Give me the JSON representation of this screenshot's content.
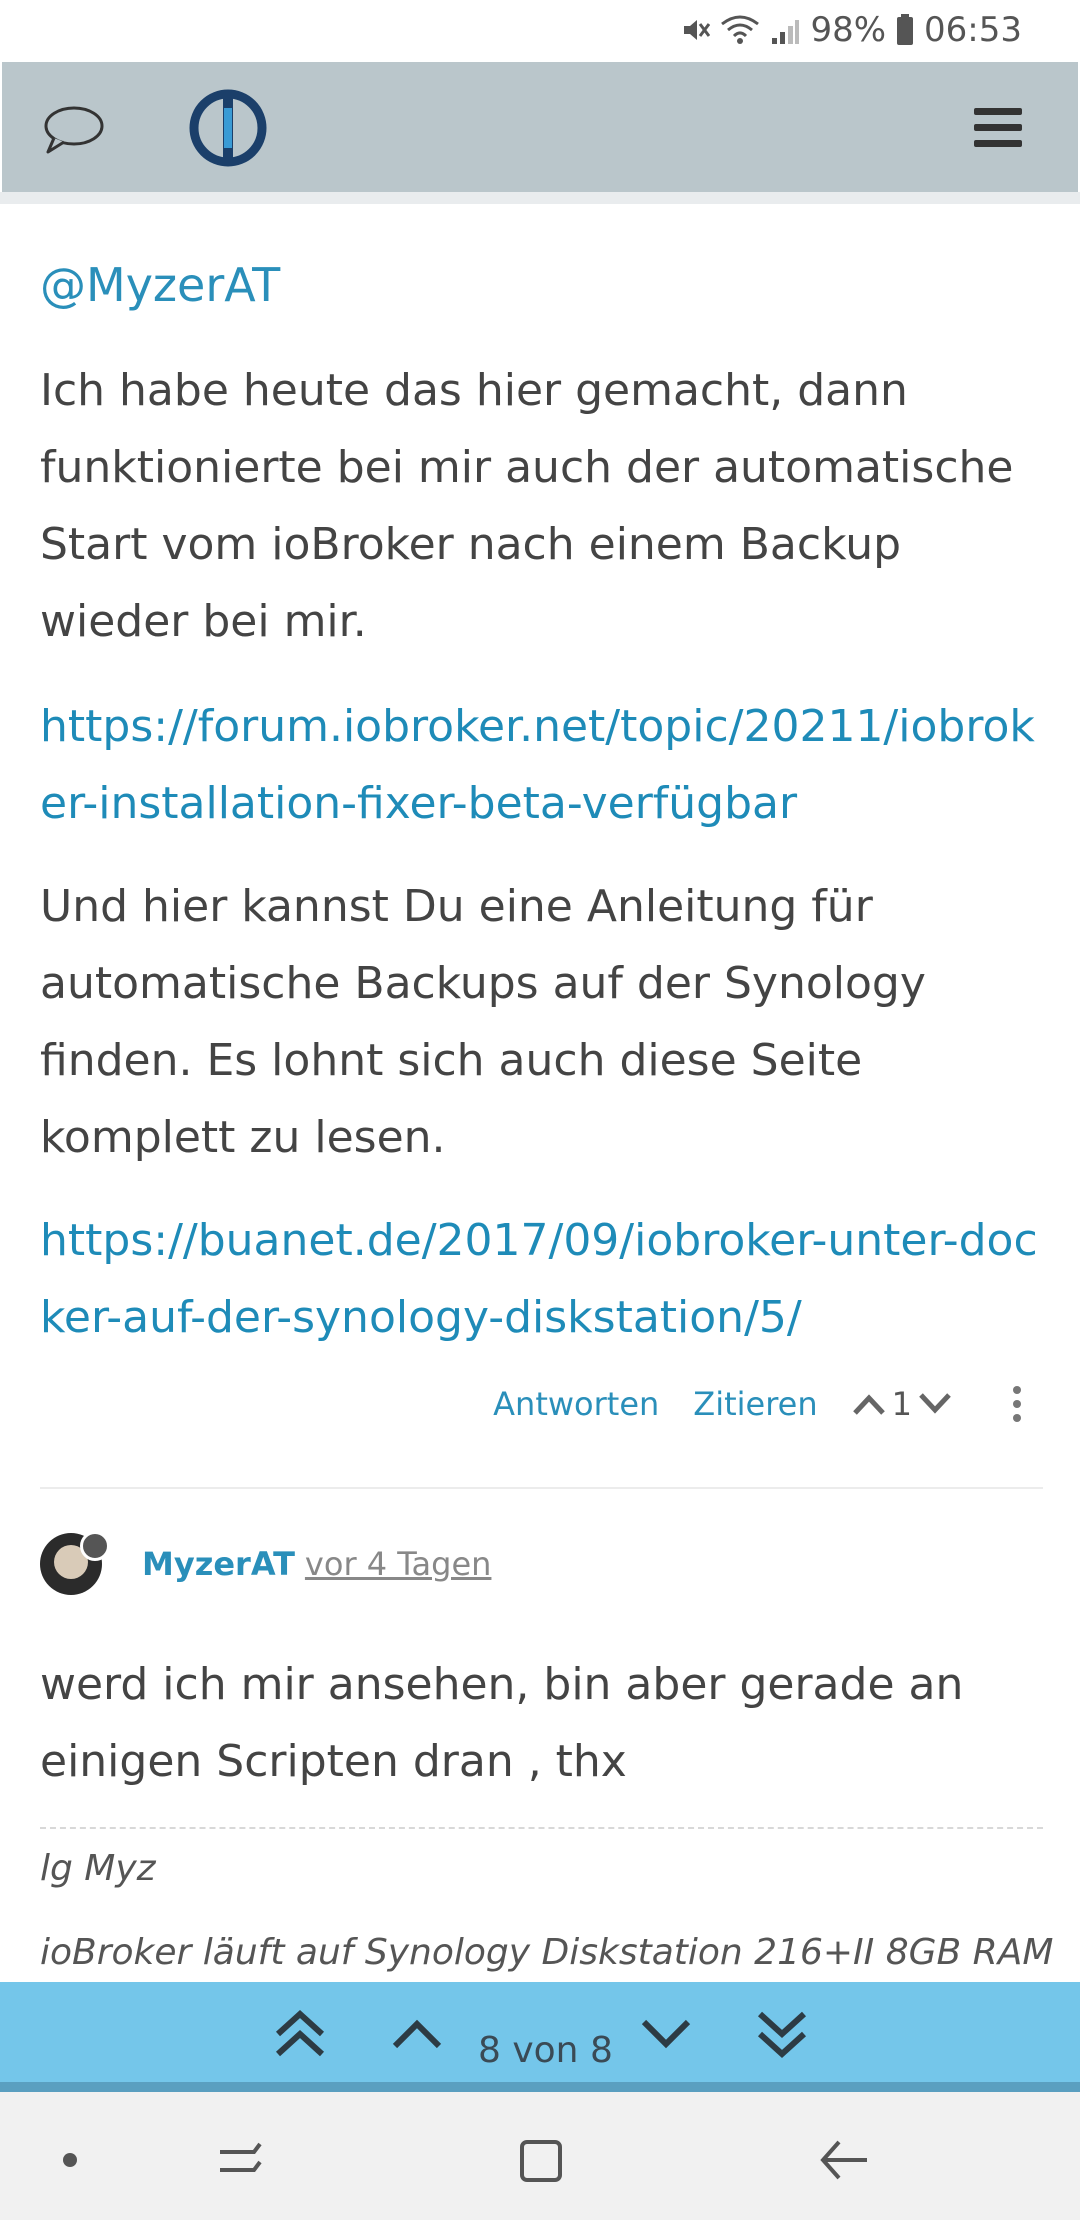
{
  "status_bar": {
    "battery": "98%",
    "time": "06:53",
    "icons": [
      "mute-icon",
      "wifi-icon",
      "signal-icon",
      "battery-icon"
    ]
  },
  "header": {
    "icons": [
      "chat-icon",
      "iobroker-logo",
      "hamburger-menu-icon"
    ]
  },
  "post1": {
    "mention": "@MyzerAT",
    "paragraph1": "Ich habe heute das hier gemacht, dann funktionierte bei mir auch der automatische Start vom ioBroker nach einem Backup wieder bei mir.",
    "link1": "https://forum.iobroker.net/topic/20211/iobroker-installation-fixer-beta-verfügbar",
    "paragraph2": "Und hier kannst Du eine Anleitung für automatische Backups auf der Synology finden. Es lohnt sich auch diese Seite komplett zu lesen.",
    "link2": "https://buanet.de/2017/09/iobroker-unter-docker-auf-der-synology-diskstation/5/",
    "actions": {
      "reply": "Antworten",
      "quote": "Zitieren",
      "votes": "1"
    }
  },
  "post2": {
    "username": "MyzerAT",
    "time_ago": "vor 4 Tagen",
    "text": "werd ich mir ansehen, bin aber gerade an einigen Scripten dran , thx",
    "signature_line1": "lg Myz",
    "signature_line2": "ioBroker läuft auf Synology Diskstation 216+II 8GB RAM"
  },
  "pagination": {
    "label": "8 von 8"
  },
  "colors": {
    "header_bg": "#bac6cb",
    "link": "#1e8bb8",
    "pagebar_bg": "#74c6ea"
  }
}
